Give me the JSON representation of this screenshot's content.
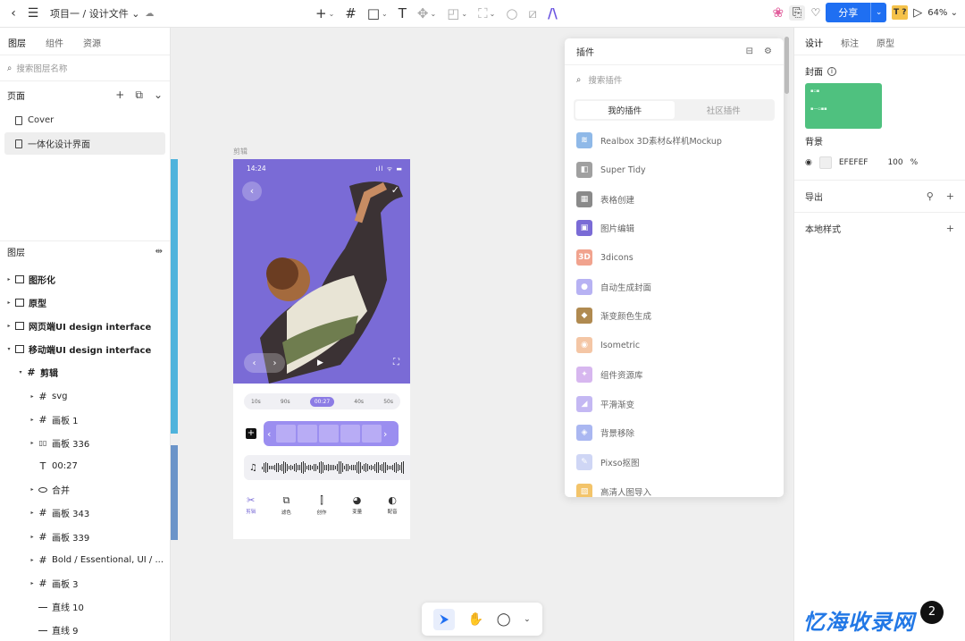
{
  "topbar": {
    "breadcrumb": "项目一 / 设计文件 ⌄",
    "share_label": "分享",
    "avatar_label": "T ?",
    "zoom": "64% ⌄"
  },
  "left": {
    "tabs": [
      "图层",
      "组件",
      "资源"
    ],
    "search_placeholder": "搜索图层名称",
    "pages_title": "页面",
    "pages": [
      "Cover",
      "一体化设计界面"
    ],
    "layers_title": "图层",
    "layers": [
      {
        "label": "图形化",
        "arrow": "▸",
        "icon": "frame",
        "indent": 0,
        "bold": true
      },
      {
        "label": "原型",
        "arrow": "▸",
        "icon": "frame",
        "indent": 0,
        "bold": true
      },
      {
        "label": "网页端UI design interface",
        "arrow": "▸",
        "icon": "frame",
        "indent": 0,
        "bold": true
      },
      {
        "label": "移动端UI design interface",
        "arrow": "▾",
        "icon": "frame",
        "indent": 0,
        "bold": true
      },
      {
        "label": "剪辑",
        "arrow": "▾",
        "icon": "hash",
        "indent": 1,
        "bold": true
      },
      {
        "label": "svg",
        "arrow": "▸",
        "icon": "hash",
        "indent": 2,
        "bold": false
      },
      {
        "label": "画板 1",
        "arrow": "▸",
        "icon": "hash",
        "indent": 2,
        "bold": false
      },
      {
        "label": "画板 336",
        "arrow": "▸",
        "icon": "cols",
        "indent": 2,
        "bold": false
      },
      {
        "label": "00:27",
        "arrow": "",
        "icon": "text",
        "indent": 2,
        "bold": false
      },
      {
        "label": "合并",
        "arrow": "▸",
        "icon": "oval",
        "indent": 2,
        "bold": false
      },
      {
        "label": "画板 343",
        "arrow": "▸",
        "icon": "hash",
        "indent": 2,
        "bold": false
      },
      {
        "label": "画板 339",
        "arrow": "▸",
        "icon": "hash",
        "indent": 2,
        "bold": false
      },
      {
        "label": "Bold / Essentional, UI / ...",
        "arrow": "▸",
        "icon": "hash",
        "indent": 2,
        "bold": false
      },
      {
        "label": "画板 3",
        "arrow": "▸",
        "icon": "hash",
        "indent": 2,
        "bold": false
      },
      {
        "label": "直线 10",
        "arrow": "",
        "icon": "line",
        "indent": 2,
        "bold": false
      },
      {
        "label": "直线 9",
        "arrow": "",
        "icon": "line",
        "indent": 2,
        "bold": false
      }
    ]
  },
  "canvas": {
    "frame_label": "剪辑",
    "phone": {
      "time": "14:24",
      "status_icons": "ıll ᯤ ▬",
      "ruler": [
        "10s",
        "90s",
        "00:27",
        "40s",
        "50s"
      ],
      "tabs": [
        "剪辑",
        "滤色",
        "创作",
        "变量",
        "配音"
      ]
    }
  },
  "plugin_panel": {
    "title": "插件",
    "search_placeholder": "搜索插件",
    "tabs": [
      "我的插件",
      "社区插件"
    ],
    "items": [
      {
        "label": "Realbox 3D素材&样机Mockup",
        "color": "#8fb9e8",
        "glyph": "≋"
      },
      {
        "label": "Super Tidy",
        "color": "#a0a0a0",
        "glyph": "◧"
      },
      {
        "label": "表格创建",
        "color": "#8a8a8a",
        "glyph": "▦"
      },
      {
        "label": "图片编辑",
        "color": "#7a6bd6",
        "glyph": "▣"
      },
      {
        "label": "3dicons",
        "color": "#f1a38e",
        "glyph": "3D"
      },
      {
        "label": "自动生成封面",
        "color": "#b7b2f3",
        "glyph": "●"
      },
      {
        "label": "渐变颜色生成",
        "color": "#b08a50",
        "glyph": "◆"
      },
      {
        "label": "Isometric",
        "color": "#f4c6a5",
        "glyph": "◉"
      },
      {
        "label": "组件资源库",
        "color": "#d7b7ef",
        "glyph": "✦"
      },
      {
        "label": "平滑渐变",
        "color": "#c4b8f3",
        "glyph": "◢"
      },
      {
        "label": "背景移除",
        "color": "#aab7f1",
        "glyph": "◈"
      },
      {
        "label": "Pixso抠图",
        "color": "#cfd6f5",
        "glyph": "✎"
      },
      {
        "label": "高清人图导入",
        "color": "#f3c46a",
        "glyph": "▧"
      }
    ]
  },
  "right": {
    "tabs": [
      "设计",
      "标注",
      "原型"
    ],
    "cover_label": "封面",
    "background_label": "背景",
    "bg_hex": "EFEFEF",
    "bg_opacity": "100",
    "bg_opacity_unit": "%",
    "export_label": "导出",
    "local_styles_label": "本地样式",
    "cover_color": "#4fc17f"
  },
  "watermark": "忆海收录网",
  "watermark_badge": "2"
}
